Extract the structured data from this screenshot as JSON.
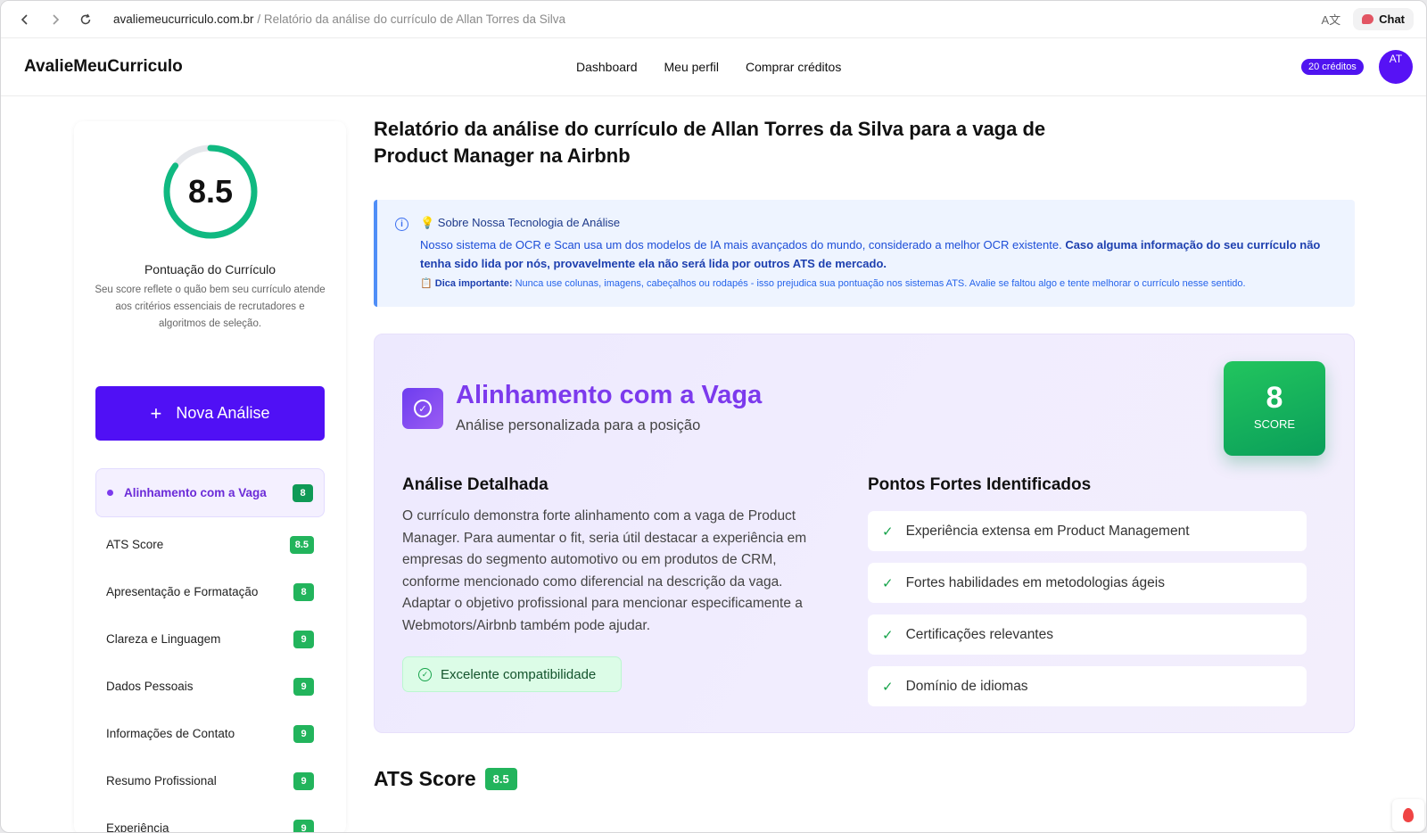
{
  "browser": {
    "domain": "avaliemeucurriculo.com.br",
    "separator": "/",
    "path": "Relatório da análise do currículo de Allan Torres da Silva",
    "chat_label": "Chat",
    "translate_icon": "A文"
  },
  "header": {
    "logo": "AvalieMeuCurriculo",
    "nav": [
      "Dashboard",
      "Meu perfil",
      "Comprar créditos"
    ],
    "credits": "20 créditos",
    "avatar_initials": "AT"
  },
  "sidebar": {
    "score": "8.5",
    "score_fraction": 0.85,
    "title": "Pontuação do Currículo",
    "description": "Seu score reflete o quão bem seu currículo atende aos critérios essenciais de recrutadores e algoritmos de seleção.",
    "new_analysis": "Nova Análise",
    "items": [
      {
        "label": "Alinhamento com a Vaga",
        "score": "8"
      },
      {
        "label": "ATS Score",
        "score": "8.5"
      },
      {
        "label": "Apresentação e Formatação",
        "score": "8"
      },
      {
        "label": "Clareza e Linguagem",
        "score": "9"
      },
      {
        "label": "Dados Pessoais",
        "score": "9"
      },
      {
        "label": "Informações de Contato",
        "score": "9"
      },
      {
        "label": "Resumo Profissional",
        "score": "9"
      },
      {
        "label": "Experiência",
        "score": "9"
      }
    ]
  },
  "main": {
    "title": "Relatório da análise do currículo de Allan Torres da Silva para a vaga de Product Manager na Airbnb",
    "info": {
      "title": "💡 Sobre Nossa Tecnologia de Análise",
      "text": "Nosso sistema de OCR e Scan usa um dos modelos de IA mais avançados do mundo, considerado a melhor OCR existente. ",
      "text_bold": "Caso alguma informação do seu currículo não tenha sido lida por nós, provavelmente ela não será lida por outros ATS de mercado.",
      "tip_label": "📋 Dica importante:",
      "tip_text": " Nunca use colunas, imagens, cabeçalhos ou rodapés - isso prejudica sua pontuação nos sistemas ATS. Avalie se faltou algo e tente melhorar o currículo nesse sentido."
    },
    "card": {
      "title": "Alinhamento com a Vaga",
      "subtitle": "Análise personalizada para a posição",
      "score": "8",
      "score_label": "SCORE",
      "analysis_title": "Análise Detalhada",
      "analysis_text": "O currículo demonstra forte alinhamento com a vaga de Product Manager. Para aumentar o fit, seria útil destacar a experiência em empresas do segmento automotivo ou em produtos de CRM, conforme mencionado como diferencial na descrição da vaga. Adaptar o objetivo profissional para mencionar especificamente a Webmotors/Airbnb também pode ajudar.",
      "compat_label": "Excelente compatibilidade",
      "strengths_title": "Pontos Fortes Identificados",
      "strengths": [
        "Experiência extensa em Product Management",
        "Fortes habilidades em metodologias ágeis",
        "Certificações relevantes",
        "Domínio de idiomas"
      ]
    },
    "ats": {
      "title": "ATS Score",
      "score": "8.5"
    }
  },
  "colors": {
    "primary": "#5010f5",
    "accent_purple": "#7c3aed",
    "success": "#22b45c",
    "info_blue": "#1d4ed8"
  }
}
